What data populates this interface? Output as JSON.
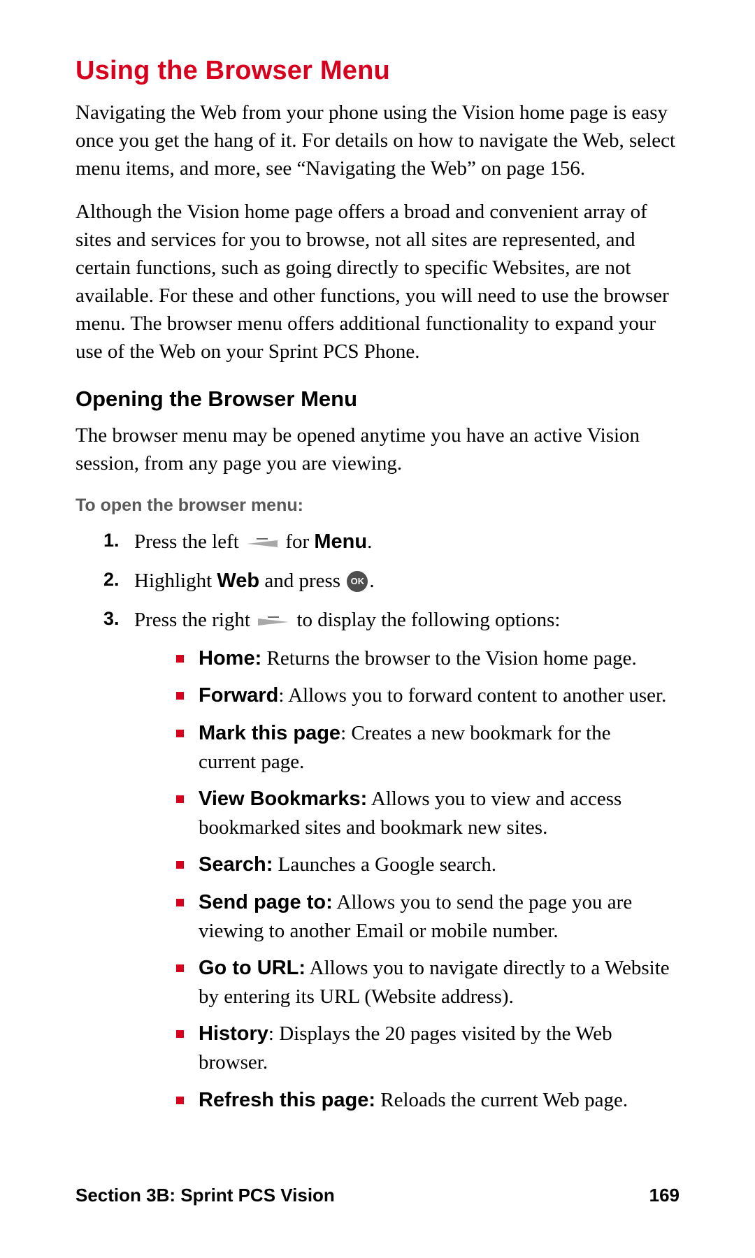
{
  "title": "Using the Browser Menu",
  "para1": "Navigating the Web from your phone using the Vision home page is easy once you get the hang of it. For details on how to navigate the Web, select menu items, and more, see “Navigating the Web” on page 156.",
  "para2": "Although the Vision home page offers a broad and convenient array of sites and services for you to browse, not all sites are represented, and certain functions, such as going directly to specific Websites, are not available. For these and other functions, you will need to use the browser menu. The browser menu offers additional functionality to expand your use of the Web on your Sprint PCS Phone.",
  "subhead": "Opening the Browser Menu",
  "para3": "The browser menu may be opened anytime you have an active Vision session, from any page you are viewing.",
  "leadlabel": "To open the browser menu:",
  "steps": {
    "n1": "1.",
    "s1_a": "Press the left ",
    "s1_b": " for ",
    "s1_menu": "Menu",
    "s1_c": ".",
    "n2": "2.",
    "s2_a": "Highlight ",
    "s2_web": "Web",
    "s2_b": " and press ",
    "s2_ok": "OK",
    "s2_c": ".",
    "n3": "3.",
    "s3_a": "Press the right ",
    "s3_b": " to display the following options:"
  },
  "options": [
    {
      "label": "Home:",
      "text": " Returns the browser to the Vision home page."
    },
    {
      "label": "Forward",
      "text": ": Allows you to forward content to another user."
    },
    {
      "label": "Mark this page",
      "text": ": Creates a new bookmark for the current page."
    },
    {
      "label": "View Bookmarks:",
      "text": " Allows you to view and access bookmarked sites and bookmark new sites."
    },
    {
      "label": "Search:",
      "text": " Launches a Google search."
    },
    {
      "label": "Send page to:",
      "text": " Allows you to send the page you are viewing to another Email or mobile number."
    },
    {
      "label": "Go to URL:",
      "text": " Allows you to navigate directly to a Website by entering its URL (Website address)."
    },
    {
      "label": "History",
      "text": ": Displays the 20 pages visited by the Web browser."
    },
    {
      "label": "Refresh this page:",
      "text": " Reloads the current Web page."
    }
  ],
  "footer_left": "Section 3B: Sprint PCS Vision",
  "footer_right": "169"
}
